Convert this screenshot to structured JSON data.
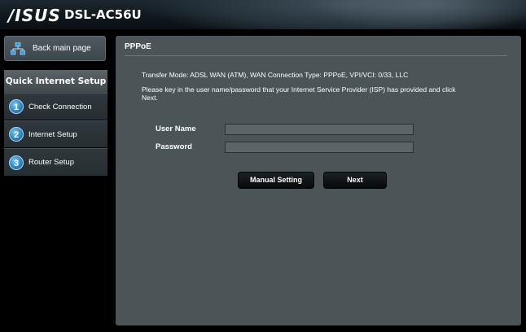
{
  "header": {
    "brand": "/ISUS",
    "model": "DSL-AC56U"
  },
  "sidebar": {
    "back_label": "Back main page",
    "section_title": "Quick Internet Setup",
    "steps": [
      {
        "number": "1",
        "label": "Check Connection"
      },
      {
        "number": "2",
        "label": "Internet Setup"
      },
      {
        "number": "3",
        "label": "Router Setup"
      }
    ]
  },
  "main": {
    "title": "PPPoE",
    "transfer_info": "Transfer Mode: ADSL WAN (ATM), WAN Connection Type: PPPoE, VPI/VCI: 0/33, LLC",
    "instruction": "Please key in the user name/password that your Internet Service Provider (ISP) has provided and click Next.",
    "username_label": "User Name",
    "username_value": "",
    "password_label": "Password",
    "password_value": "",
    "manual_button": "Manual Setting",
    "next_button": "Next"
  },
  "colors": {
    "panel_bg": "#4b5558",
    "step_circle": "#2a86c4",
    "button_bg": "#0b0e10"
  }
}
